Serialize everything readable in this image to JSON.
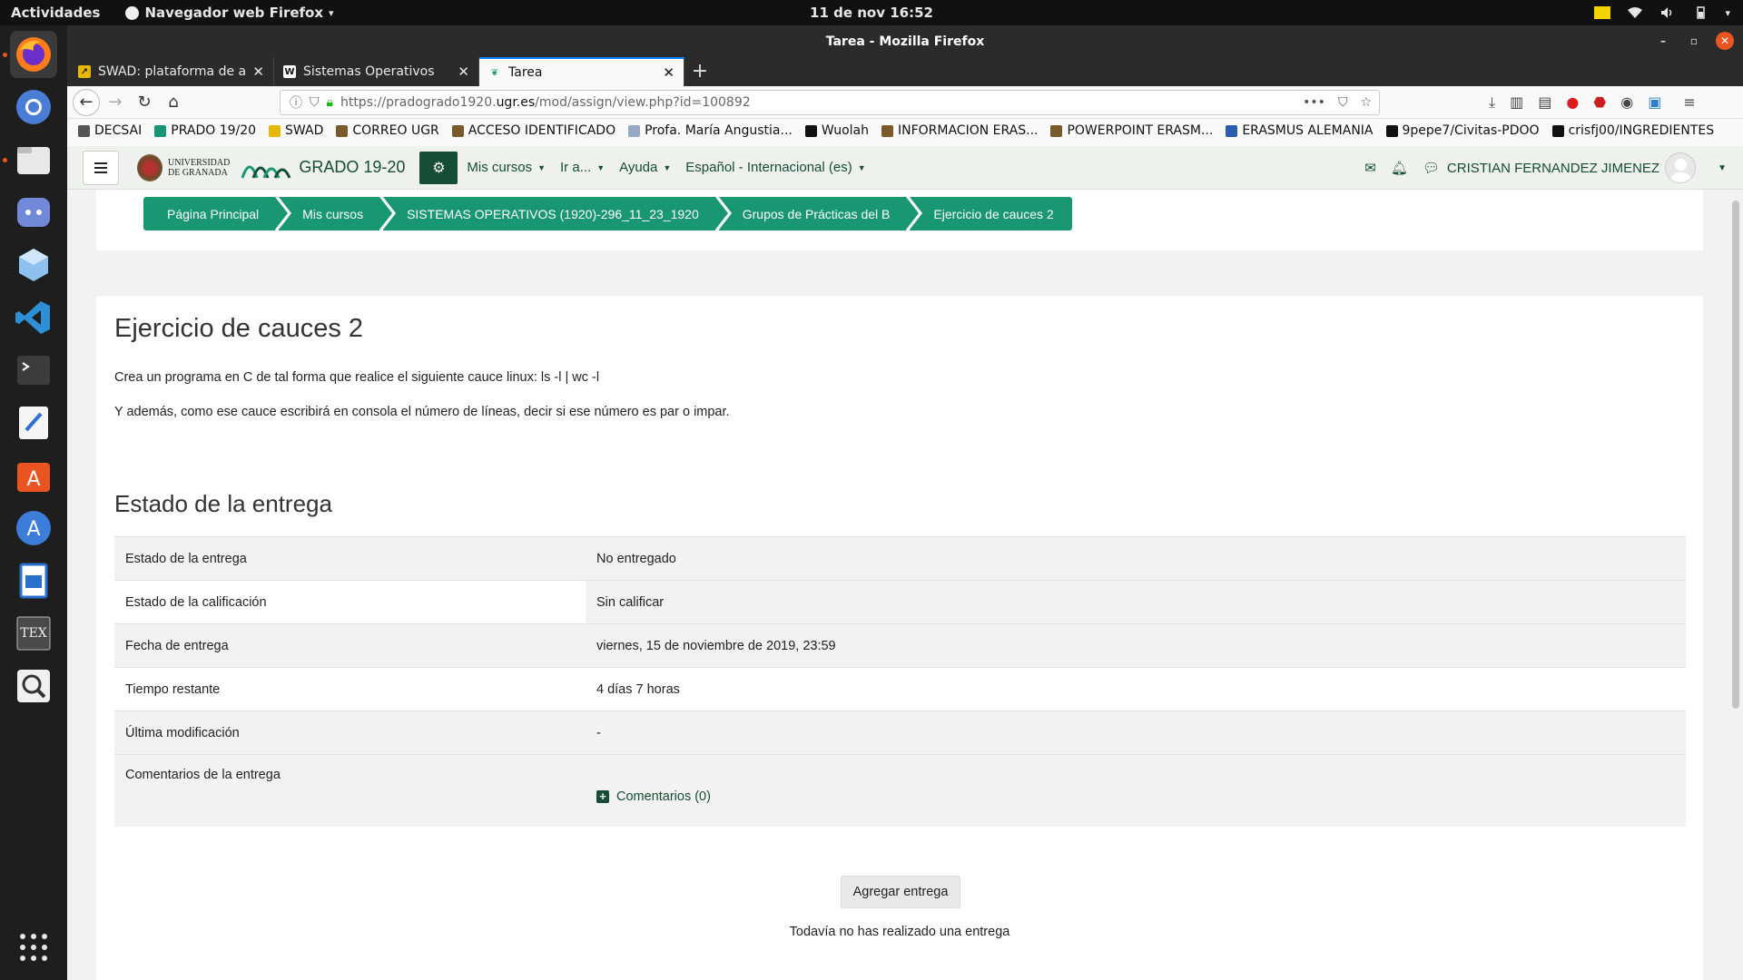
{
  "topbar": {
    "activities": "Actividades",
    "app_name": "Navegador web Firefox",
    "app_caret": "▾",
    "clock": "11 de nov  16:52"
  },
  "window": {
    "title": "Tarea - Mozilla Firefox"
  },
  "tabs": [
    {
      "label": "SWAD: plataforma de ap",
      "favicon_color": "#e7b800",
      "favicon_text": "↗"
    },
    {
      "label": "Sistemas Operativos",
      "favicon_color": "#111111",
      "favicon_text": "W"
    },
    {
      "label": "Tarea",
      "favicon_color": "#189772",
      "favicon_text": ""
    }
  ],
  "url": {
    "prefix": "https://pradogrado1920.",
    "host": "ugr.es",
    "path": "/mod/assign/view.php?id=100892"
  },
  "bookmarks": [
    {
      "label": "DECSAI",
      "color": "#555555"
    },
    {
      "label": "PRADO 19/20",
      "color": "#189772"
    },
    {
      "label": "SWAD",
      "color": "#e7b800"
    },
    {
      "label": "CORREO UGR",
      "color": "#7a5a2a"
    },
    {
      "label": "ACCESO IDENTIFICADO",
      "color": "#7a5a2a"
    },
    {
      "label": "Profa. María Angustia...",
      "color": "#9aa8c8"
    },
    {
      "label": "Wuolah",
      "color": "#111111"
    },
    {
      "label": "INFORMACION ERAS...",
      "color": "#7a5a2a"
    },
    {
      "label": "POWERPOINT ERASM...",
      "color": "#7a5a2a"
    },
    {
      "label": "ERASMUS ALEMANIA",
      "color": "#2a5db0"
    },
    {
      "label": "9pepe7/Civitas-PDOO",
      "color": "#111111"
    },
    {
      "label": "crisfj00/INGREDIENTES",
      "color": "#111111"
    }
  ],
  "moodle_nav": {
    "uni_line1": "UNIVERSIDAD",
    "uni_line2": "DE GRANADA",
    "site": "GRADO 19-20",
    "menus": [
      "Mis cursos",
      "Ir a...",
      "Ayuda",
      "Español - Internacional (es)"
    ],
    "user": "CRISTIAN FERNANDEZ JIMENEZ"
  },
  "breadcrumb": [
    "Página Principal",
    "Mis cursos",
    "SISTEMAS OPERATIVOS (1920)-296_11_23_1920",
    "Grupos de Prácticas del B",
    "Ejercicio de cauces 2"
  ],
  "assignment": {
    "title": "Ejercicio de cauces 2",
    "intro1": "Crea un programa en C de tal forma que realice el siguiente cauce linux: ls -l | wc -l",
    "intro2": "Y además, como ese cauce escribirá en consola el número de líneas, decir si ese número es par o impar.",
    "status_heading": "Estado de la entrega",
    "rows": [
      {
        "key": "Estado de la entrega",
        "value": "No entregado"
      },
      {
        "key": "Estado de la calificación",
        "value": "Sin calificar"
      },
      {
        "key": "Fecha de entrega",
        "value": "viernes, 15 de noviembre de 2019, 23:59"
      },
      {
        "key": "Tiempo restante",
        "value": "4 días 7 horas"
      },
      {
        "key": "Última modificación",
        "value": "-"
      },
      {
        "key": "Comentarios de la entrega",
        "value": "Comentarios (0)"
      }
    ],
    "add_button": "Agregar entrega",
    "no_submission": "Todavía no has realizado una entrega"
  },
  "colors": {
    "brand_green": "#154d37",
    "breadcrumb_green": "#189772",
    "ubuntu_orange": "#e95420"
  },
  "dock_icons": [
    "firefox-icon",
    "chromium-icon",
    "files-icon",
    "discord-icon",
    "virtualbox-icon",
    "vscode-icon",
    "terminal-icon",
    "text-editor-icon",
    "software-center-icon",
    "app-store-icon",
    "writer-icon",
    "texmaker-icon",
    "search-icon",
    "show-apps-icon"
  ]
}
